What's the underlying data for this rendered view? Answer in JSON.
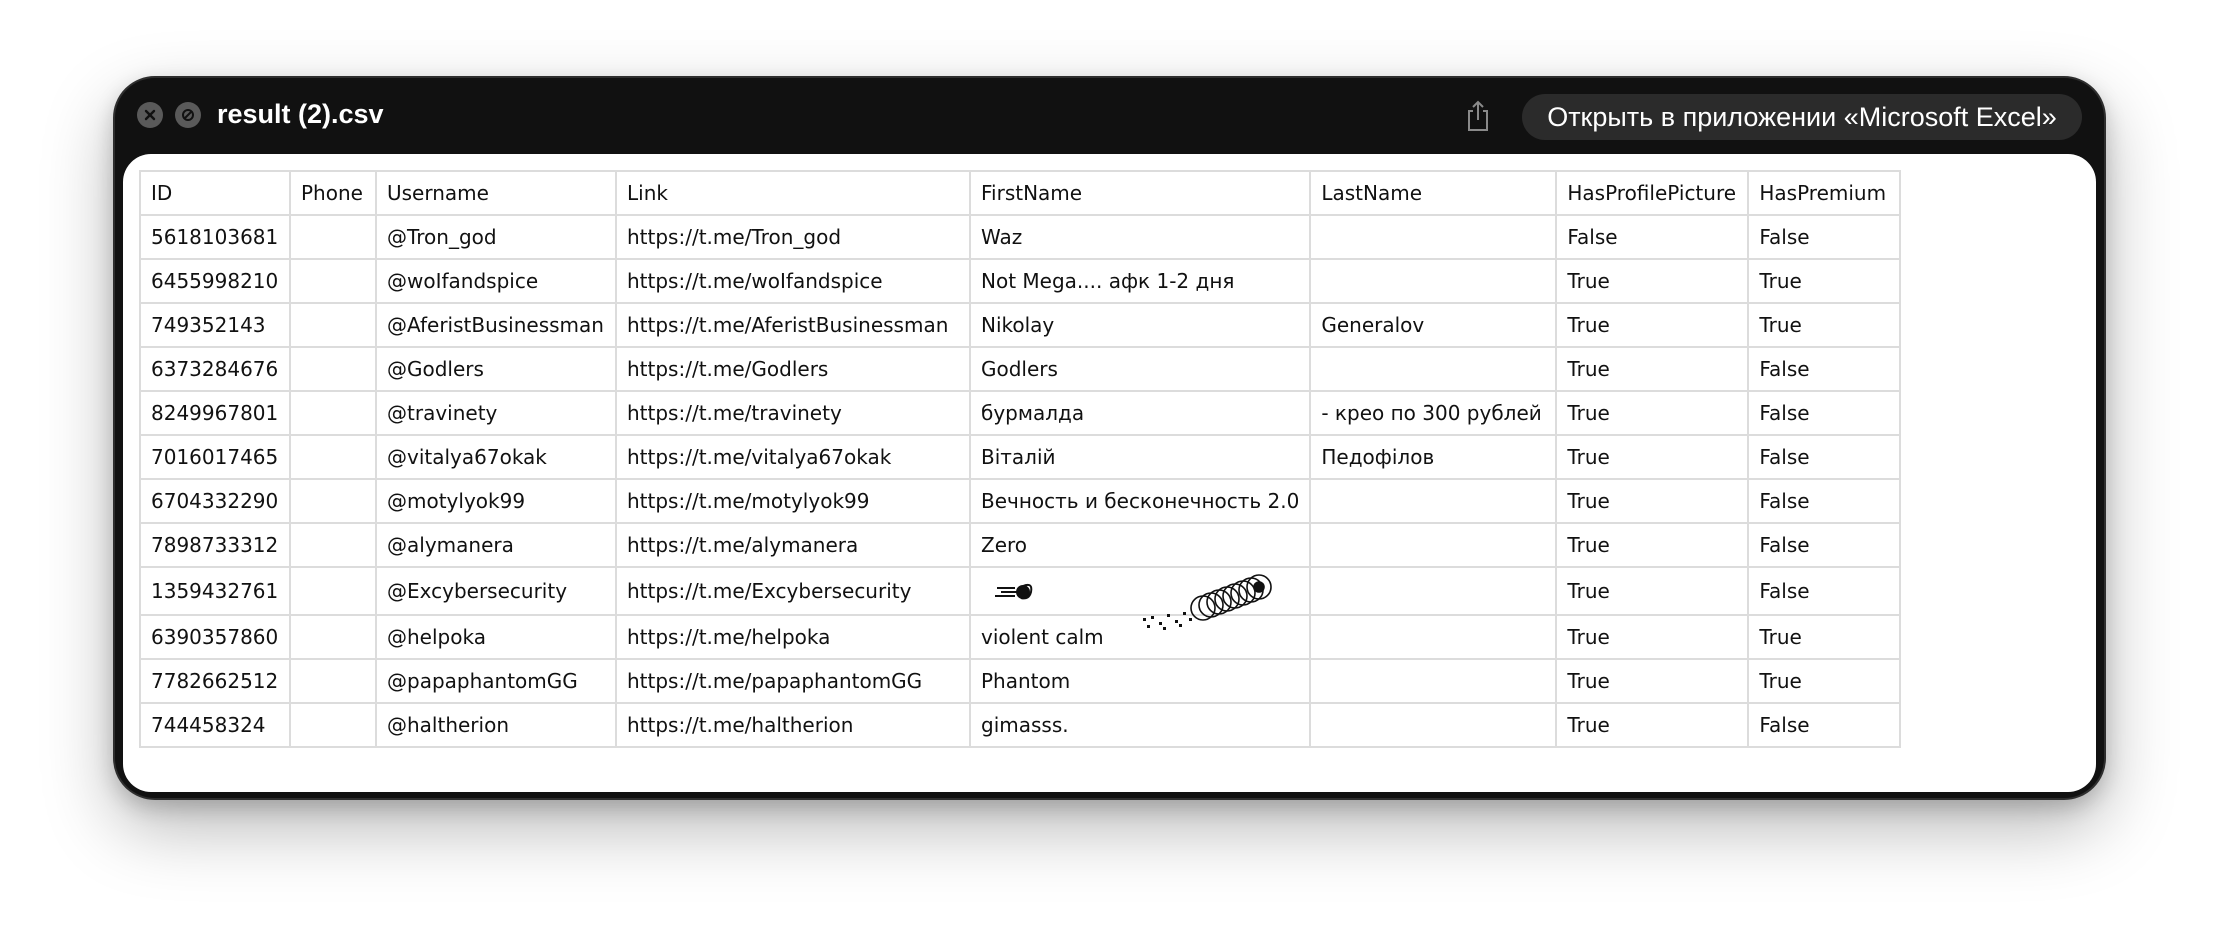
{
  "window": {
    "title": "result (2).csv",
    "open_app_label": "Открыть в приложении «Microsoft Excel»",
    "close_icon": "close-icon",
    "hide_icon": "hide-icon",
    "share_icon": "share-icon"
  },
  "table": {
    "headers": [
      "ID",
      "Phone",
      "Username",
      "Link",
      "FirstName",
      "LastName",
      "HasProfilePicture",
      "HasPremium"
    ],
    "rows": [
      [
        "5618103681",
        "",
        "@Tron_god",
        "https://t.me/Tron_god",
        "Waz",
        "",
        "False",
        "False"
      ],
      [
        "6455998210",
        "",
        "@woIfandspice",
        "https://t.me/woIfandspice",
        "Not Mega.... афк 1-2 дня",
        "",
        "True",
        "True"
      ],
      [
        "749352143",
        "",
        "@AferistBusinessman",
        "https://t.me/AferistBusinessman",
        "Nikolay",
        "Generalov",
        "True",
        "True"
      ],
      [
        "6373284676",
        "",
        "@Godlers",
        "https://t.me/Godlers",
        "Godlers",
        "",
        "True",
        "False"
      ],
      [
        "8249967801",
        "",
        "@travinety",
        "https://t.me/travinety",
        "бурмалда",
        "- крео по 300 рублей",
        "True",
        "False"
      ],
      [
        "7016017465",
        "",
        "@vitalya67okak",
        "https://t.me/vitalya67okak",
        "Віталій",
        "Педофілов",
        "True",
        "False"
      ],
      [
        "6704332290",
        "",
        "@motylyok99",
        "https://t.me/motylyok99",
        "Вечность и бесконечность 2.0",
        "",
        "True",
        "False"
      ],
      [
        "7898733312",
        "",
        "@alymanera",
        "https://t.me/alymanera",
        "Zero",
        "",
        "True",
        "False"
      ],
      [
        "1359432761",
        "",
        "@Excybersecurity",
        "https://t.me/Excybersecurity",
        "",
        "",
        "True",
        "False"
      ],
      [
        "6390357860",
        "",
        "@helpoka",
        "https://t.me/helpoka",
        "violent calm",
        "",
        "True",
        "True"
      ],
      [
        "7782662512",
        "",
        "@papaphantomGG",
        "https://t.me/papaphantomGG",
        "Phantom",
        "",
        "True",
        "True"
      ],
      [
        "744458324",
        "",
        "@haltherion",
        "https://t.me/haltherion",
        "gimasss.",
        "",
        "True",
        "False"
      ]
    ]
  }
}
